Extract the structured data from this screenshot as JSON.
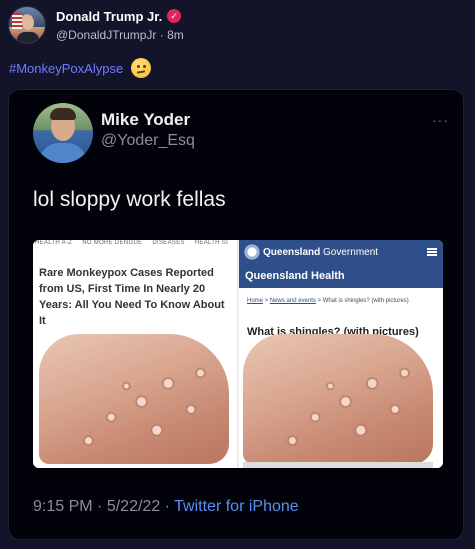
{
  "outer_tweet": {
    "author_name": "Donald Trump Jr.",
    "verified_glyph": "✓",
    "handle": "@DonaldJTrumpJr",
    "separator": "·",
    "time_ago": "8m",
    "hashtag": "#MonkeyPoxAlypse",
    "emoji": "face-with-rolling-eyes"
  },
  "quoted_tweet": {
    "author_name": "Mike Yoder",
    "handle": "@Yoder_Esq",
    "more_glyph": "···",
    "text": "lol sloppy work fellas",
    "time": "9:15 PM",
    "dot1": "·",
    "date": "5/22/22",
    "dot2": "·",
    "source": "Twitter for iPhone"
  },
  "screenshot_left": {
    "nav_items": [
      "HEALTH A-Z",
      "NO MORE DENGUE",
      "DISEASES",
      "HEALTH SI"
    ],
    "headline": "Rare Monkeypox Cases Reported from US, First Time In Nearly 20 Years: All You Need To Know About It"
  },
  "screenshot_right": {
    "gov_bold": "Queensland",
    "gov_rest": " Government",
    "site_name": "Queensland Health",
    "crumb_home": "Home",
    "crumb_sep1": " > ",
    "crumb_news": "News and events",
    "crumb_sep2": " > ",
    "crumb_page": "What is shingles? (with pictures)",
    "title": "What is shingles? (with pictures)"
  },
  "colors": {
    "background": "#13132a",
    "card": "#02020a",
    "hashtag": "#6e7cff",
    "source_link": "#5b8ff0",
    "verified_badge": "#e0245e",
    "qld_blue": "#2f4f8a"
  }
}
